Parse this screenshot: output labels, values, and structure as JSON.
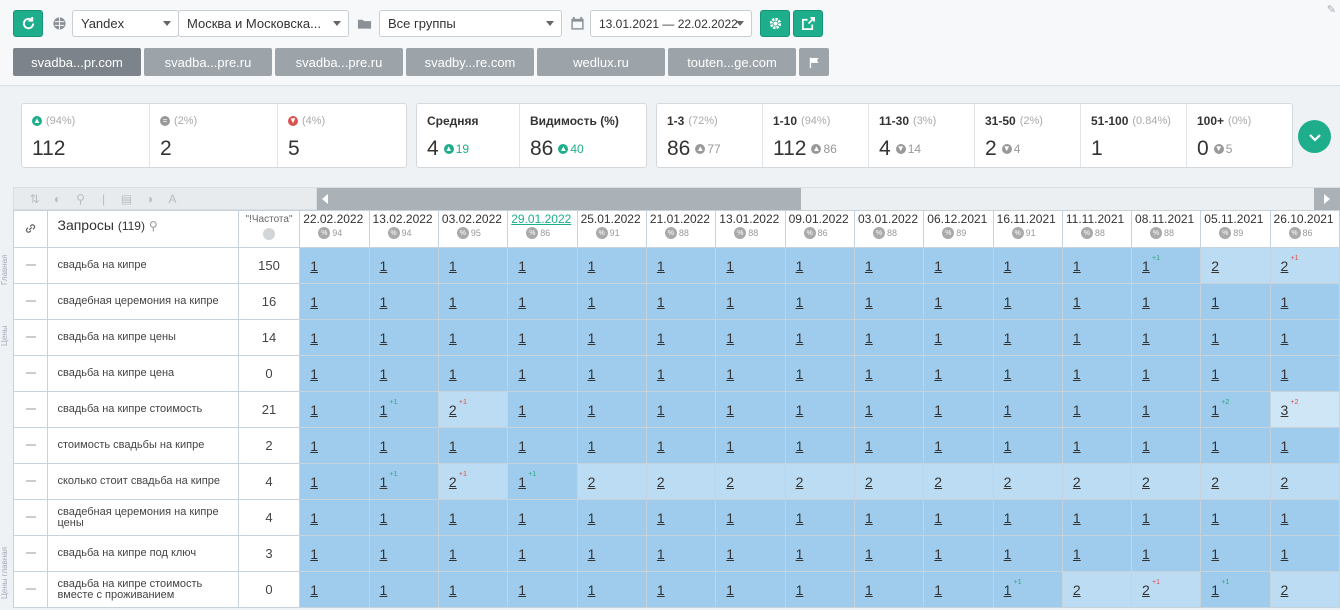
{
  "toolbar": {
    "engine": "Yandex",
    "region": "Москва и Московска...",
    "groups": "Все группы",
    "date_range": "13.01.2021 — 22.02.2022"
  },
  "sites": [
    "svadba...pr.com",
    "svadba...pre.ru",
    "svadba...pre.ru",
    "svadby...re.com",
    "wedlux.ru",
    "touten...ge.com"
  ],
  "stats": {
    "up": {
      "pct": "(94%)",
      "value": "112"
    },
    "same": {
      "pct": "(2%)",
      "value": "2"
    },
    "down": {
      "pct": "(4%)",
      "value": "5"
    },
    "avg": {
      "label": "Средняя",
      "value": "4",
      "delta": "19"
    },
    "vis": {
      "label": "Видимость (%)",
      "value": "86",
      "delta": "40"
    },
    "r1": {
      "label": "1-3",
      "pct": "(72%)",
      "value": "86",
      "delta": "77"
    },
    "r2": {
      "label": "1-10",
      "pct": "(94%)",
      "value": "112",
      "delta": "86"
    },
    "r3": {
      "label": "11-30",
      "pct": "(3%)",
      "value": "4",
      "delta": "14"
    },
    "r4": {
      "label": "31-50",
      "pct": "(2%)",
      "value": "2",
      "delta": "4"
    },
    "r5": {
      "label": "51-100",
      "pct": "(0.84%)",
      "value": "1",
      "delta": ""
    },
    "r6": {
      "label": "100+",
      "pct": "(0%)",
      "value": "0",
      "delta": "5"
    }
  },
  "table": {
    "query_header": "Запросы",
    "query_count": "(119)",
    "freq_header": "\"!Частота\"",
    "side_labels": [
      "Главная",
      "Цены",
      "Цены главная"
    ],
    "dates": [
      {
        "d": "22.02.2022",
        "v": "94"
      },
      {
        "d": "13.02.2022",
        "v": "94"
      },
      {
        "d": "03.02.2022",
        "v": "95"
      },
      {
        "d": "29.01.2022",
        "v": "86",
        "hl": true
      },
      {
        "d": "25.01.2022",
        "v": "91"
      },
      {
        "d": "21.01.2022",
        "v": "88"
      },
      {
        "d": "13.01.2022",
        "v": "88"
      },
      {
        "d": "09.01.2022",
        "v": "86"
      },
      {
        "d": "03.01.2022",
        "v": "88"
      },
      {
        "d": "06.12.2021",
        "v": "89"
      },
      {
        "d": "16.11.2021",
        "v": "91"
      },
      {
        "d": "11.11.2021",
        "v": "88"
      },
      {
        "d": "08.11.2021",
        "v": "88"
      },
      {
        "d": "05.11.2021",
        "v": "89"
      },
      {
        "d": "26.10.2021",
        "v": "86"
      }
    ],
    "rows": [
      {
        "q": "свадьба на кипре",
        "f": "150",
        "p": [
          "1",
          "1",
          "1",
          "1",
          "1",
          "1",
          "1",
          "1",
          "1",
          "1",
          "1",
          "1",
          "1",
          "2",
          "2"
        ],
        "c": {
          "12": "+1",
          "14": "+1"
        }
      },
      {
        "q": "свадебная церемония на кипре",
        "f": "16",
        "p": [
          "1",
          "1",
          "1",
          "1",
          "1",
          "1",
          "1",
          "1",
          "1",
          "1",
          "1",
          "1",
          "1",
          "1",
          "1"
        ],
        "c": {}
      },
      {
        "q": "свадьба на кипре цены",
        "f": "14",
        "p": [
          "1",
          "1",
          "1",
          "1",
          "1",
          "1",
          "1",
          "1",
          "1",
          "1",
          "1",
          "1",
          "1",
          "1",
          "1"
        ],
        "c": {}
      },
      {
        "q": "свадьба на кипре цена",
        "f": "0",
        "p": [
          "1",
          "1",
          "1",
          "1",
          "1",
          "1",
          "1",
          "1",
          "1",
          "1",
          "1",
          "1",
          "1",
          "1",
          "1"
        ],
        "c": {}
      },
      {
        "q": "свадьба на кипре стоимость",
        "f": "21",
        "p": [
          "1",
          "1",
          "2",
          "1",
          "1",
          "1",
          "1",
          "1",
          "1",
          "1",
          "1",
          "1",
          "1",
          "1",
          "3"
        ],
        "c": {
          "1": "+1",
          "2": "+1",
          "13": "+2",
          "14": "+2"
        }
      },
      {
        "q": "стоимость свадьбы на кипре",
        "f": "2",
        "p": [
          "1",
          "1",
          "1",
          "1",
          "1",
          "1",
          "1",
          "1",
          "1",
          "1",
          "1",
          "1",
          "1",
          "1",
          "1"
        ],
        "c": {}
      },
      {
        "q": "сколько стоит свадьба на кипре",
        "f": "4",
        "p": [
          "1",
          "1",
          "2",
          "1",
          "2",
          "2",
          "2",
          "2",
          "2",
          "2",
          "2",
          "2",
          "2",
          "2",
          "2"
        ],
        "c": {
          "1": "+1",
          "2": "+1",
          "3": "+1"
        }
      },
      {
        "q": "свадебная церемония на кипре цены",
        "f": "4",
        "p": [
          "1",
          "1",
          "1",
          "1",
          "1",
          "1",
          "1",
          "1",
          "1",
          "1",
          "1",
          "1",
          "1",
          "1",
          "1"
        ],
        "c": {}
      },
      {
        "q": "свадьба на кипре под ключ",
        "f": "3",
        "p": [
          "1",
          "1",
          "1",
          "1",
          "1",
          "1",
          "1",
          "1",
          "1",
          "1",
          "1",
          "1",
          "1",
          "1",
          "1"
        ],
        "c": {}
      },
      {
        "q": "свадьба на кипре стоимость вместе с проживанием",
        "f": "0",
        "p": [
          "1",
          "1",
          "1",
          "1",
          "1",
          "1",
          "1",
          "1",
          "1",
          "1",
          "1",
          "2",
          "2",
          "1",
          "2"
        ],
        "c": {
          "10": "+1",
          "12": "+1",
          "13": "+1"
        }
      }
    ]
  }
}
